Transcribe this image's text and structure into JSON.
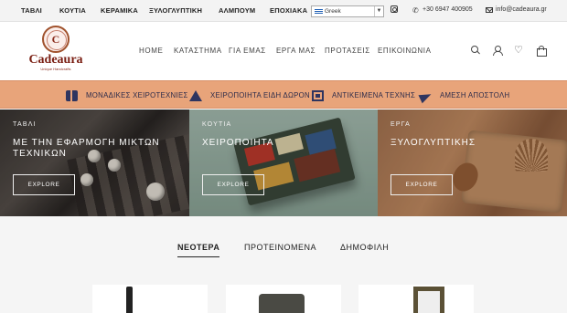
{
  "topbar": {
    "categories": [
      "ΤΑΒΛΙ",
      "ΚΟΥΤΙΑ",
      "ΚΕΡΑΜΙΚΑ",
      "ΞΥΛΟΓΛΥΠΤΙΚΗ",
      "ΑΛΜΠΟΥΜ",
      "ΕΠΟΧΙΑΚΑ"
    ],
    "language": "Greek",
    "phone": "+30 6947 400905",
    "email": "info@cadeaura.gr"
  },
  "logo": {
    "letter": "C",
    "brand": "Cadeaura",
    "tagline": "Unique Handcrafts"
  },
  "nav": [
    "HOME",
    "ΚΑΤΑΣΤΗΜΑ",
    "ΓΙΑ ΕΜΑΣ",
    "ΕΡΓΑ ΜΑΣ",
    "ΠΡΟΤΑΣΕΙΣ",
    "ΕΠΙΚΟΙΝΩΝΙΑ"
  ],
  "features": [
    {
      "label": "ΜΟΝΑΔΙΚΕΣ ΧΕΙΡΟΤΕΧΝΙΕΣ",
      "icon": "gift-icon"
    },
    {
      "label": "ΧΕΙΡΟΠΟΙΗΤΑ ΕΙΔΗ ΔΩΡΟΝ",
      "icon": "warning-icon"
    },
    {
      "label": "ΑΝΤΙΚΕΙΜΕΝΑ ΤΕΧΝΗΣ",
      "icon": "frame-icon"
    },
    {
      "label": "ΑΜΕΣΗ ΑΠΟΣΤΟΛΗ",
      "icon": "send-icon"
    }
  ],
  "banners": [
    {
      "tag": "ΤΑΒΛΙ",
      "title": "ΜΕ ΤΗΝ ΕΦΑΡΜΟΓΗ ΜΙΚΤΩΝ ΤΕΧΝΙΚΩΝ",
      "button": "EXPLORE"
    },
    {
      "tag": "ΚΟΥΤΙΑ",
      "title": "ΧΕΙΡΟΠΟΙΗΤΑ",
      "button": "EXPLORE"
    },
    {
      "tag": "ΕΡΓΑ",
      "title": "ΞΥΛΟΓΛΥΠΤΙΚΗΣ",
      "button": "EXPLORE"
    }
  ],
  "tabs": [
    "ΝΕΟΤΕΡΑ",
    "ΠΡΟΤΕΙΝΟΜΕΝΑ",
    "ΔΗΜΟΦΙΛΗ"
  ],
  "colors": {
    "feature_strip": "#e8a47a",
    "icon_navy": "#2e3560",
    "brand": "#7a1e12"
  }
}
